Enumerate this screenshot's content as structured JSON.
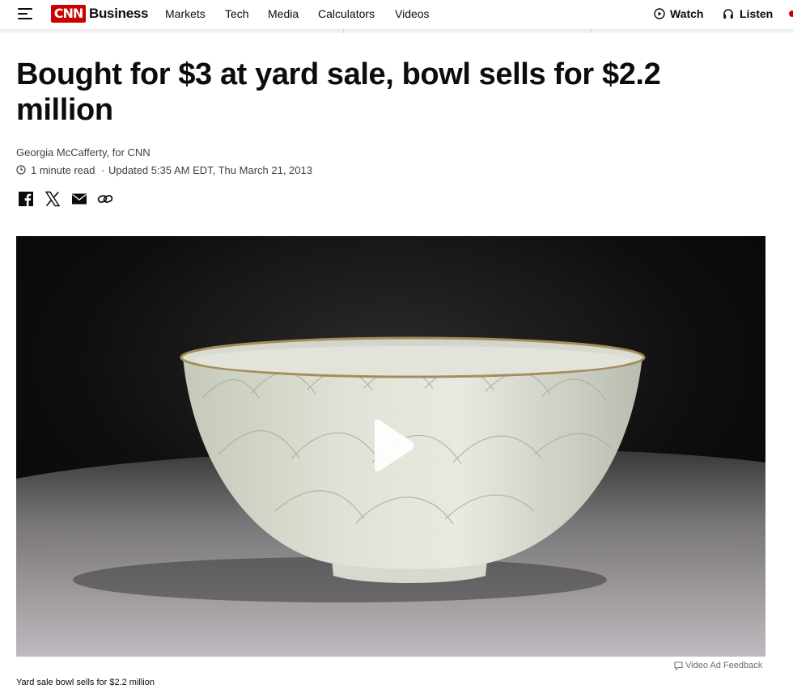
{
  "header": {
    "logo_brand": "CNN",
    "logo_section": "Business",
    "nav_items": [
      "Markets",
      "Tech",
      "Media",
      "Calculators",
      "Videos"
    ],
    "watch_label": "Watch",
    "listen_label": "Listen"
  },
  "article": {
    "headline": "Bought for $3 at yard sale, bowl sells for $2.2 million",
    "byline": "Georgia McCafferty, for CNN",
    "read_time": "1 minute read",
    "separator": "·",
    "updated": "Updated 5:35 AM EDT, Thu March 21, 2013"
  },
  "share_icons": [
    "facebook-icon",
    "x-icon",
    "email-icon",
    "link-icon"
  ],
  "video": {
    "ad_feedback_label": "Video Ad Feedback",
    "caption": "Yard sale bowl sells for $2.2 million"
  },
  "colors": {
    "brand_red": "#cc0000",
    "text": "#0c0c0c",
    "meta_text": "#404040"
  }
}
